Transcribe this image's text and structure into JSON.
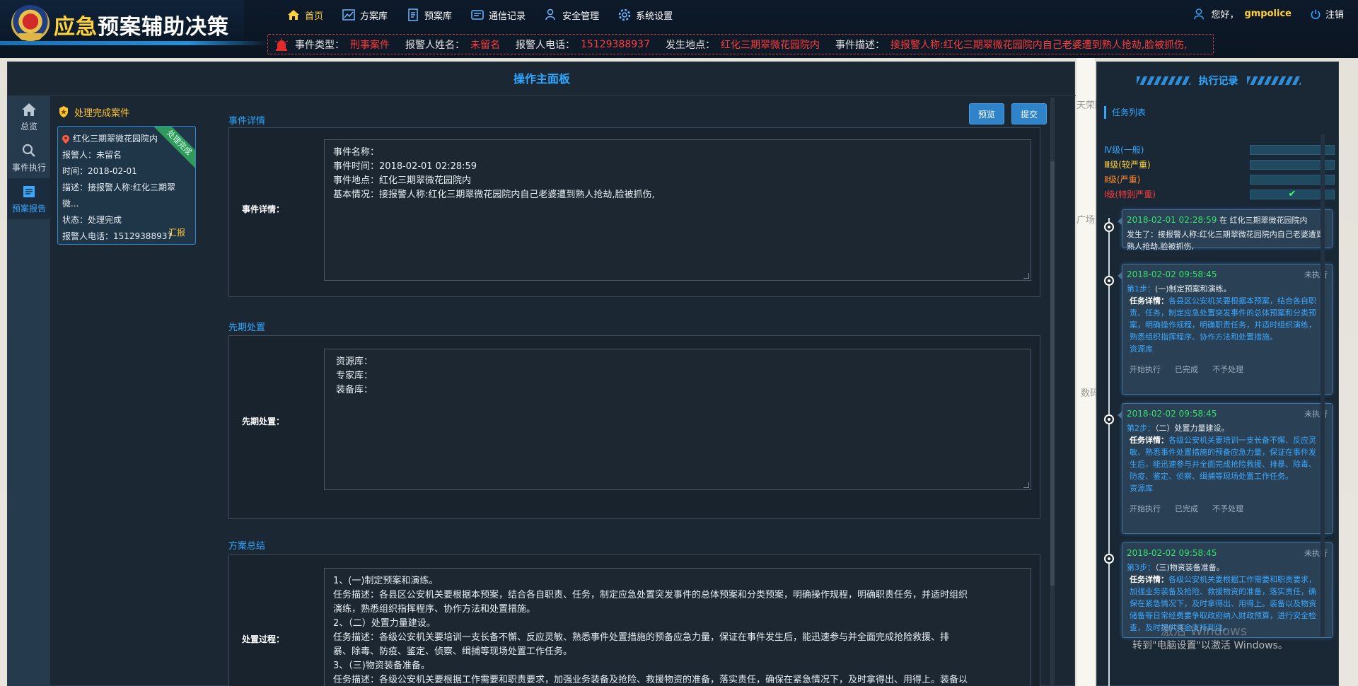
{
  "header": {
    "title_highlight": "应急",
    "title_rest": "预案辅助决策",
    "nav": [
      {
        "label": "首页",
        "icon": "home-icon",
        "active": true
      },
      {
        "label": "方案库",
        "icon": "chart-icon",
        "active": false
      },
      {
        "label": "预案库",
        "icon": "document-icon",
        "active": false
      },
      {
        "label": "通信记录",
        "icon": "phone-record-icon",
        "active": false
      },
      {
        "label": "安全管理",
        "icon": "user-shield-icon",
        "active": false
      },
      {
        "label": "系统设置",
        "icon": "gear-icon",
        "active": false
      }
    ],
    "greeting": "您好，",
    "username": "gmpolice",
    "logout": "注销"
  },
  "ticker": {
    "type_label": "事件类型：",
    "type_value": "刑事案件",
    "name_label": "报警人姓名：",
    "name_value": "未留名",
    "phone_label": "报警人电话：",
    "phone_value": "15129388937",
    "place_label": "发生地点：",
    "place_value": "红化三期翠微花园院内",
    "desc_label": "事件描述：",
    "desc_value": "接报警人称:红化三期翠微花园院内自己老婆遭到熟人抢劫,脸被抓伤,"
  },
  "main": {
    "title": "操作主面板",
    "leftnav": [
      {
        "label": "总览",
        "icon": "home-icon",
        "active": false
      },
      {
        "label": "事件执行",
        "icon": "search-icon",
        "active": false
      },
      {
        "label": "预案报告",
        "icon": "report-icon",
        "active": true
      }
    ],
    "cases_title": "处理完成案件",
    "case": {
      "ribbon": "处理完成",
      "location": "红化三期翠微花园院内",
      "reporter": "报警人：未留名",
      "time": "时间：2018-02-01",
      "desc": "描述：接报警人称:红化三期翠微...",
      "status": "状态：处理完成",
      "phone": "报警人电话：15129388937",
      "report_link": "汇报"
    },
    "buttons": {
      "preview": "预览",
      "submit": "提交"
    },
    "sections": {
      "detail_title": "事件详情",
      "detail_label": "事件详情：",
      "detail_lines": [
        "事件名称：",
        "事件时间：2018-02-01 02:28:59",
        "事件地点：红化三期翠微花园院内",
        "基本情况：接报警人称:红化三期翠微花园院内自己老婆遭到熟人抢劫,脸被抓伤,"
      ],
      "prelim_title": "先期处置",
      "prelim_label": "先期处置：",
      "prelim_lines": [
        "资源库：",
        "专家库：",
        "装备库："
      ],
      "summary_title": "方案总结",
      "summary_label": "处置过程：",
      "summary_lines": [
        "1、(一)制定预案和演练。",
        "任务描述：各县区公安机关要根据本预案，结合各自职责、任务，制定应急处置突发事件的总体预案和分类预案，明确操作规程，明确职责任务，并适时组织",
        "演练，熟悉组织指挥程序、协作方法和处置措施。",
        "2、（二）处置力量建设。",
        "任务描述：各级公安机关要培训一支长备不懈、反应灵敏、熟悉事件处置措施的预备应急力量，保证在事件发生后，能迅速参与并全面完成抢险救援、排",
        "暴、除毒、防疫、鉴定、侦察、缉捕等现场处置工作任务。",
        "3、（三)物资装备准备。",
        "任务描述：各级公安机关要根据工作需要和职责要求，加强业务装备及抢险、救援物资的准备，落实责任，确保在紧急情况下，及时拿得出、用得上。装备以"
      ]
    }
  },
  "right": {
    "title": "执行记录",
    "task_list": "任务列表",
    "levels": [
      {
        "label": "Ⅳ级(一般)",
        "color": "#3aa8ff",
        "checked": false
      },
      {
        "label": "Ⅲ级(较严重)",
        "color": "#ffd23a",
        "checked": false
      },
      {
        "label": "Ⅱ级(严重)",
        "color": "#ff8a2b",
        "checked": false
      },
      {
        "label": "Ⅰ级(特别严重)",
        "color": "#ff3b3b",
        "checked": true
      }
    ],
    "check_mark": "✔",
    "event_card": {
      "time": "2018-02-01 02:28:59",
      "place_prefix": " 在 ",
      "place": "红化三期翠微花园院内",
      "desc": "发生了：接报警人称:红化三期翠微花园院内自己老婆遭到熟人抢劫,脸被抓伤,"
    },
    "steps": [
      {
        "time": "2018-02-02 09:58:45",
        "status": "未执行",
        "step_label": "第1步：",
        "step_text": "(一)制定预案和演练。",
        "detail_label": "任务详情：",
        "detail": "各县区公安机关要根据本预案，结合各自职责、任务，制定应急处置突发事件的总体预案和分类预案，明确操作规程，明确职责任务，并适时组织演练，熟悉组织指挥程序、协作方法和处置措施。",
        "resource": "资源库",
        "actions": [
          "开始执行",
          "已完成",
          "不予处理"
        ]
      },
      {
        "time": "2018-02-02 09:58:45",
        "status": "未执行",
        "step_label": "第2步：",
        "step_text": "（二）处置力量建设。",
        "detail_label": "任务详情：",
        "detail": "各级公安机关要培训一支长备不懈、反应灵敏、熟悉事件处置措施的预备应急力量，保证在事件发生后，能迅速参与并全面完成抢险救援、排暴、除毒、防疫、鉴定、侦察、缉捕等现场处置工作任务。",
        "resource": "资源库",
        "actions": [
          "开始执行",
          "已完成",
          "不予处理"
        ]
      },
      {
        "time": "2018-02-02 09:58:45",
        "status": "未执行",
        "step_label": "第3步：",
        "step_text": "（三)物资装备准备。",
        "detail_label": "任务详情：",
        "detail": "各级公安机关要根据工作需要和职责要求，加强业务装备及抢险、救援物资的准备，落实责任，确保在紧急情况下，及时拿得出、用得上。装备以及物资储备等日常经费要争取政府纳入财政预算，进行安全检查，及时提供资金支持到位。",
        "resource": "",
        "actions": []
      }
    ],
    "watermark": "转到\"电脑设置\"以激活 Windows。",
    "watermark_big": "激活 Windows"
  },
  "map_labels": [
    "广场",
    "数码",
    "天荣园"
  ]
}
